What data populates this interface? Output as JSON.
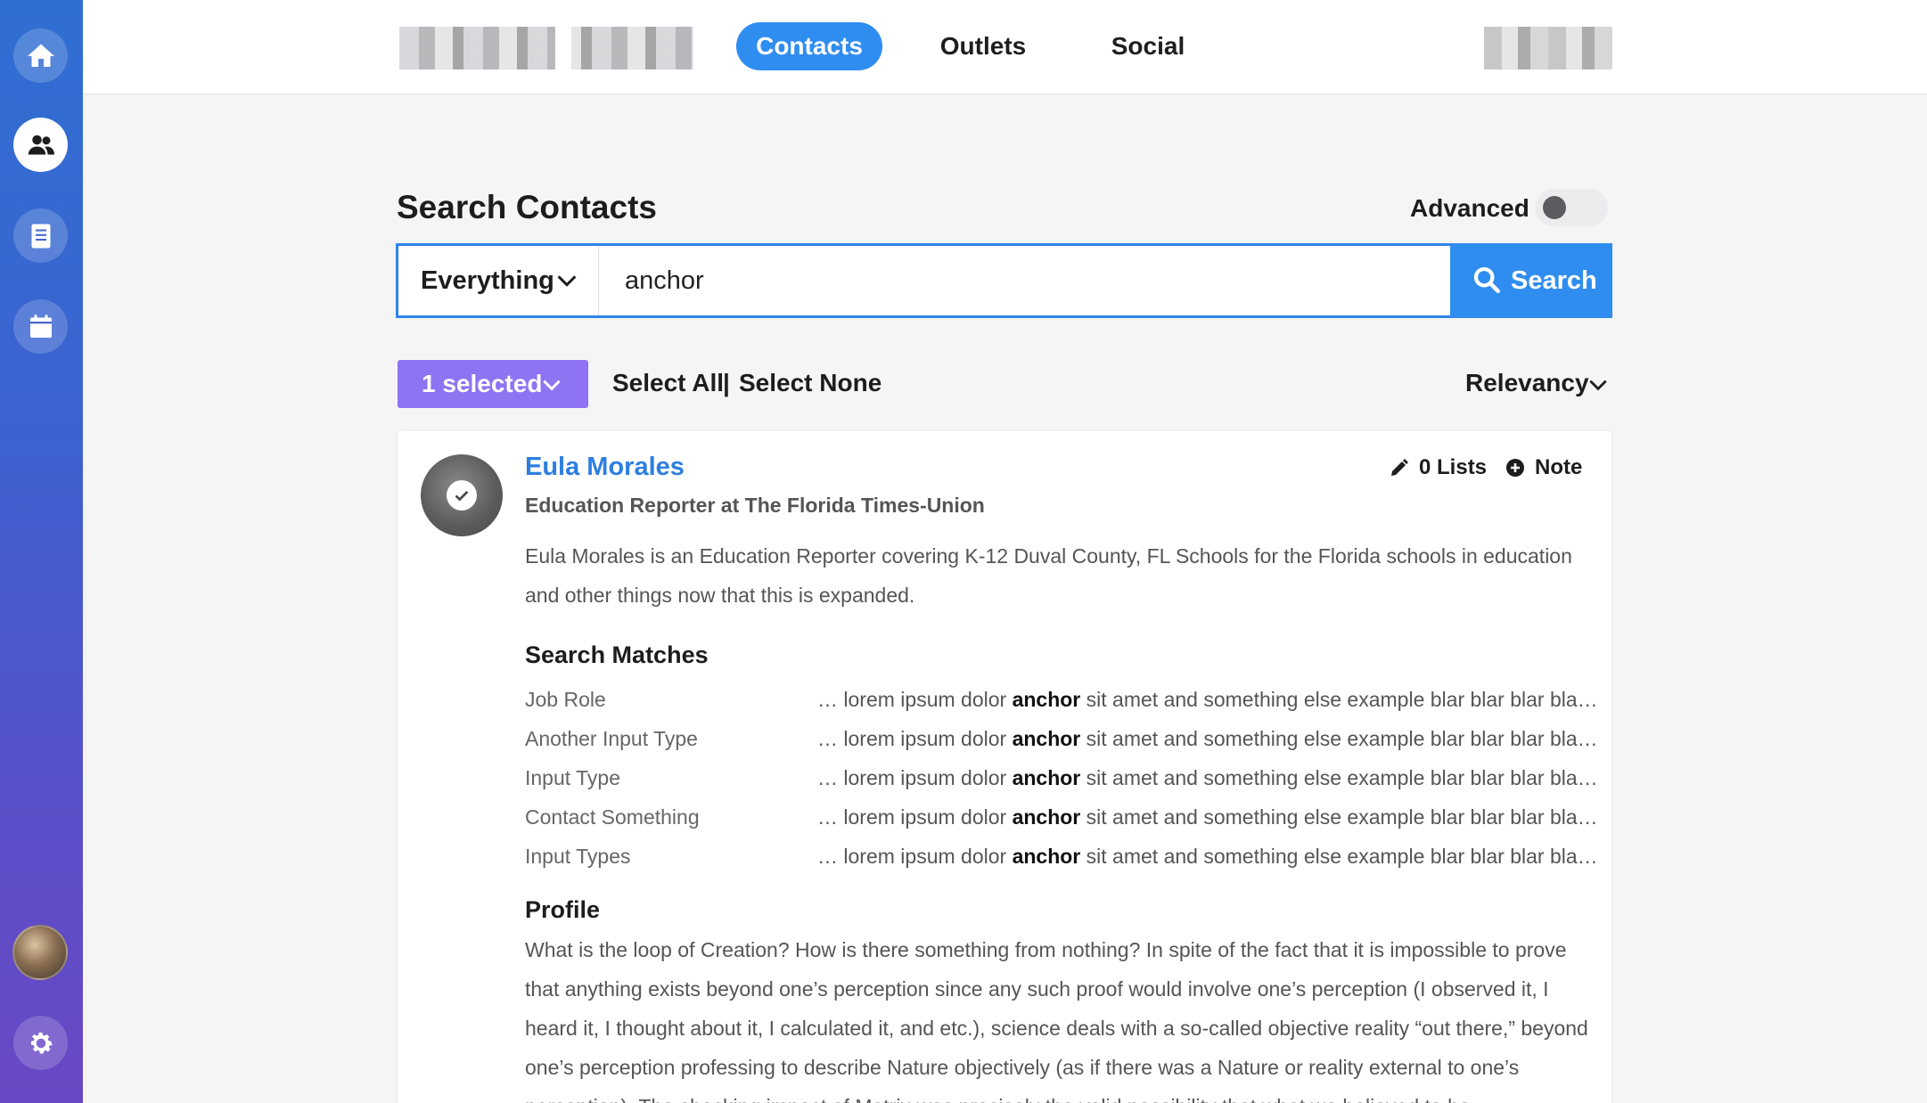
{
  "sidebar": {
    "items": [
      {
        "icon": "home-icon"
      },
      {
        "icon": "contacts-icon",
        "active": true
      },
      {
        "icon": "document-icon"
      },
      {
        "icon": "calendar-icon"
      }
    ],
    "settings_icon": "gear-icon"
  },
  "header": {
    "tabs": [
      {
        "label": "Contacts",
        "active": true
      },
      {
        "label": "Outlets"
      },
      {
        "label": "Social"
      }
    ]
  },
  "search": {
    "title": "Search Contacts",
    "advanced_label": "Advanced",
    "advanced_on": false,
    "scope": "Everything",
    "query": "anchor",
    "button_label": "Search"
  },
  "selection": {
    "selected_label": "1 selected",
    "select_all": "Select All",
    "separator": "|",
    "select_none": "Select None",
    "sort_label": "Relevancy"
  },
  "contact": {
    "name": "Eula Morales",
    "title": "Education Reporter at The Florida Times-Union",
    "lists_label": "0 Lists",
    "note_label": "Note",
    "description": "Eula Morales is an Education Reporter covering K-12 Duval County, FL Schools for the Florida schools in education and other things now that this is expanded.",
    "matches_heading": "Search Matches",
    "matches": [
      {
        "label": "Job Role",
        "before": "… lorem ipsum dolor ",
        "term": "anchor",
        "after": " sit amet and something else example blar blar blar bla…"
      },
      {
        "label": "Another Input Type",
        "before": "… lorem ipsum dolor ",
        "term": "anchor",
        "after": " sit amet and something else example blar blar blar bla…"
      },
      {
        "label": "Input Type",
        "before": "… lorem ipsum dolor ",
        "term": "anchor",
        "after": " sit amet and something else example blar blar blar bla…"
      },
      {
        "label": "Contact Something",
        "before": "… lorem ipsum dolor ",
        "term": "anchor",
        "after": " sit amet and something else example blar blar blar bla…"
      },
      {
        "label": "Input Types",
        "before": "… lorem ipsum dolor ",
        "term": "anchor",
        "after": " sit amet and something else example blar blar blar bla…"
      }
    ],
    "profile_heading": "Profile",
    "profile_text": "What is the loop of Creation? How is there something from nothing? In spite of the fact that it is impossible to prove that anything exists beyond one’s perception since any such proof would involve one’s perception (I observed it, I heard it, I thought about it, I calculated it, and etc.), science deals with a so-called objective reality “out there,” beyond one’s perception professing to describe Nature objectively (as if there was a Nature or reality external to one’s perception). The shocking impact of Matrix was precisely the valid possibility that what we believed to be"
  },
  "colors": {
    "accent": "#2f8df0",
    "selected": "#8e73f2",
    "link": "#2d7fe0"
  }
}
